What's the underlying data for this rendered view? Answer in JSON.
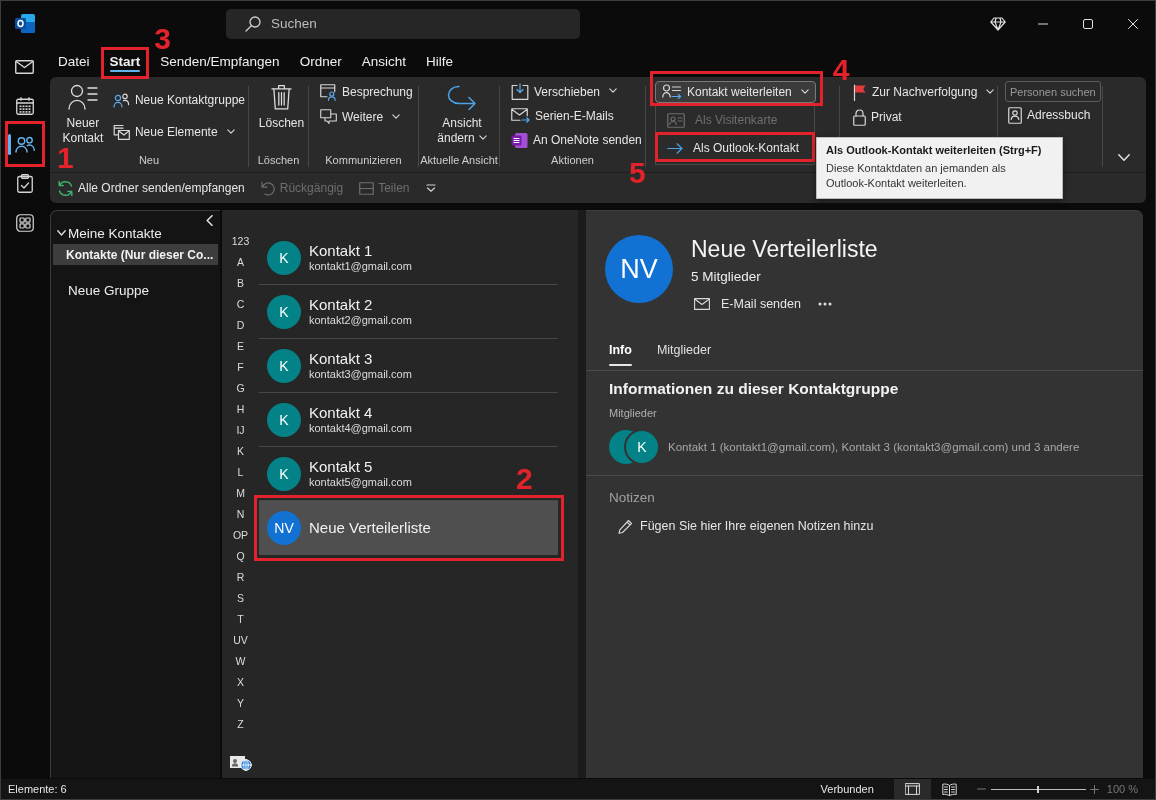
{
  "title_bar": {
    "search": {
      "placeholder": "Suchen"
    }
  },
  "nav_rail": [
    {
      "selected": false
    },
    {
      "selected": false
    },
    {
      "selected": true,
      "callout": "1"
    },
    {
      "selected": false
    },
    {
      "selected": false
    }
  ],
  "menu_tabs": [
    {
      "label": "Datei",
      "selected": false
    },
    {
      "label": "Start",
      "selected": true,
      "callout": "3"
    },
    {
      "label": "Senden/Empfangen",
      "selected": false
    },
    {
      "label": "Ordner",
      "selected": false
    },
    {
      "label": "Ansicht",
      "selected": false
    },
    {
      "label": "Hilfe",
      "selected": false
    }
  ],
  "ribbon": {
    "groups": [
      {
        "label": "Neu",
        "items": [
          {
            "kind": "large",
            "label": "Neuer Kontakt",
            "dropdown": false
          },
          {
            "kind": "small",
            "label": "Neue Kontaktgruppe",
            "dropdown": false
          },
          {
            "kind": "small",
            "label": "Neue Elemente",
            "dropdown": true
          }
        ]
      },
      {
        "label": "Löschen",
        "items": [
          {
            "kind": "large",
            "label": "Löschen",
            "dropdown": false
          }
        ]
      },
      {
        "label": "Kommunizieren",
        "items": [
          {
            "kind": "small",
            "label": "Besprechung",
            "dropdown": false
          },
          {
            "kind": "small",
            "label": "Weitere",
            "dropdown": true
          }
        ]
      },
      {
        "label": "Aktuelle Ansicht",
        "items": [
          {
            "kind": "large",
            "label": "Ansicht ändern",
            "dropdown": true
          }
        ]
      },
      {
        "label": "Aktionen",
        "items": [
          {
            "kind": "small",
            "label": "Verschieben",
            "dropdown": true
          },
          {
            "kind": "small",
            "label": "Serien-E-Mails",
            "dropdown": false
          },
          {
            "kind": "small",
            "label": "An OneNote senden",
            "dropdown": false
          }
        ]
      },
      {
        "items": [
          {
            "kind": "menu",
            "label": "Kontakt weiterleiten",
            "dropdown": true,
            "expanded": true,
            "callout": "4",
            "menu": [
              {
                "label": "Als Visitenkarte",
                "disabled": true
              },
              {
                "label": "Als Outlook-Kontakt",
                "disabled": false,
                "callout": "5",
                "tooltip": {
                  "title": "Als Outlook-Kontakt weiterleiten (Strg+F)",
                  "text": "Diese Kontaktdaten an jemanden als Outlook-Kontakt weiterleiten."
                }
              }
            ]
          }
        ]
      },
      {
        "items": [
          {
            "kind": "small",
            "label": "Zur Nachverfolgung",
            "dropdown": true
          },
          {
            "kind": "small",
            "label": "Privat",
            "dropdown": false
          }
        ]
      },
      {
        "items": [
          {
            "kind": "field",
            "placeholder": "Personen suchen"
          },
          {
            "kind": "small",
            "label": "Adressbuch",
            "dropdown": false
          }
        ]
      }
    ],
    "quick_access": [
      {
        "label": "Alle Ordner senden/empfangen",
        "disabled": false
      },
      {
        "label": "Rückgängig",
        "disabled": true
      },
      {
        "label": "Teilen",
        "disabled": true
      }
    ]
  },
  "folders": {
    "groups": [
      {
        "label": "Meine Kontakte",
        "expanded": true,
        "children": [
          {
            "label": "Kontakte (Nur dieser Co...",
            "selected": true
          }
        ]
      },
      {
        "label": "Neue Gruppe"
      }
    ]
  },
  "alphabet": [
    "123",
    "A",
    "B",
    "C",
    "D",
    "E",
    "F",
    "G",
    "H",
    "IJ",
    "K",
    "L",
    "M",
    "N",
    "OP",
    "Q",
    "R",
    "S",
    "T",
    "UV",
    "W",
    "X",
    "Y",
    "Z"
  ],
  "contacts": [
    {
      "name": "Kontakt 1",
      "email": "kontakt1@gmail.com",
      "initials": "K",
      "color": "#038387",
      "selected": false
    },
    {
      "name": "Kontakt 2",
      "email": "kontakt2@gmail.com",
      "initials": "K",
      "color": "#038387",
      "selected": false
    },
    {
      "name": "Kontakt 3",
      "email": "kontakt3@gmail.com",
      "initials": "K",
      "color": "#038387",
      "selected": false
    },
    {
      "name": "Kontakt 4",
      "email": "kontakt4@gmail.com",
      "initials": "K",
      "color": "#038387",
      "selected": false
    },
    {
      "name": "Kontakt 5",
      "email": "kontakt5@gmail.com",
      "initials": "K",
      "color": "#038387",
      "selected": false
    },
    {
      "name": "Neue Verteilerliste",
      "initials": "NV",
      "color": "#1272d3",
      "selected": true,
      "callout": "2"
    }
  ],
  "reading_pane": {
    "initials": "NV",
    "title": "Neue Verteilerliste",
    "subtitle": "5 Mitglieder",
    "actions": [
      {
        "label": "E-Mail senden"
      }
    ],
    "tabs": [
      {
        "label": "Info",
        "selected": true
      },
      {
        "label": "Mitglieder",
        "selected": false
      }
    ],
    "info": {
      "heading": "Informationen zu dieser Kontaktgruppe",
      "members_label": "Mitglieder",
      "member_avatar": {
        "initials": "K"
      },
      "members_text": "Kontakt 1 (kontakt1@gmail.com), Kontakt 3 (kontakt3@gmail.com) und 3 andere"
    },
    "notes": {
      "heading": "Notizen",
      "prompt": "Fügen Sie hier Ihre eigenen Notizen hinzu"
    }
  },
  "status_bar": {
    "item_count": "Elemente: 6",
    "connection": "Verbunden",
    "views": [
      {
        "selected": true
      },
      {
        "selected": false
      }
    ],
    "zoom": {
      "level": 0.5,
      "reading": "100 %"
    }
  }
}
